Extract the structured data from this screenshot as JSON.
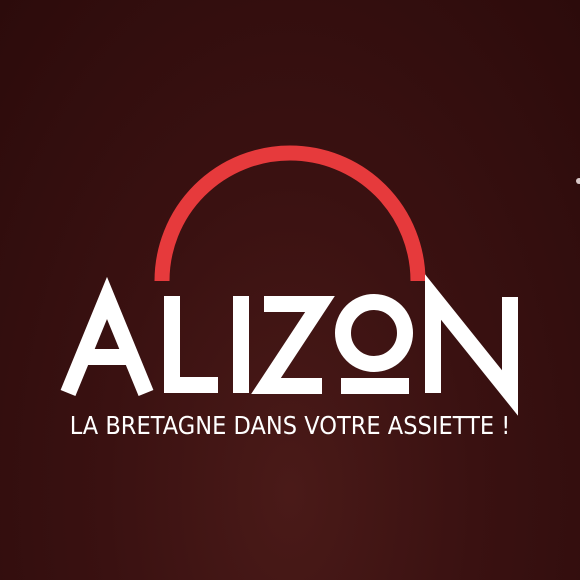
{
  "brand": {
    "name": "ALIZON",
    "tagline": "LA BRETAGNE DANS VOTRE ASSIETTE !"
  },
  "colors": {
    "background": "#3a1111",
    "arc": "#e63a3c",
    "text": "#ffffff"
  }
}
